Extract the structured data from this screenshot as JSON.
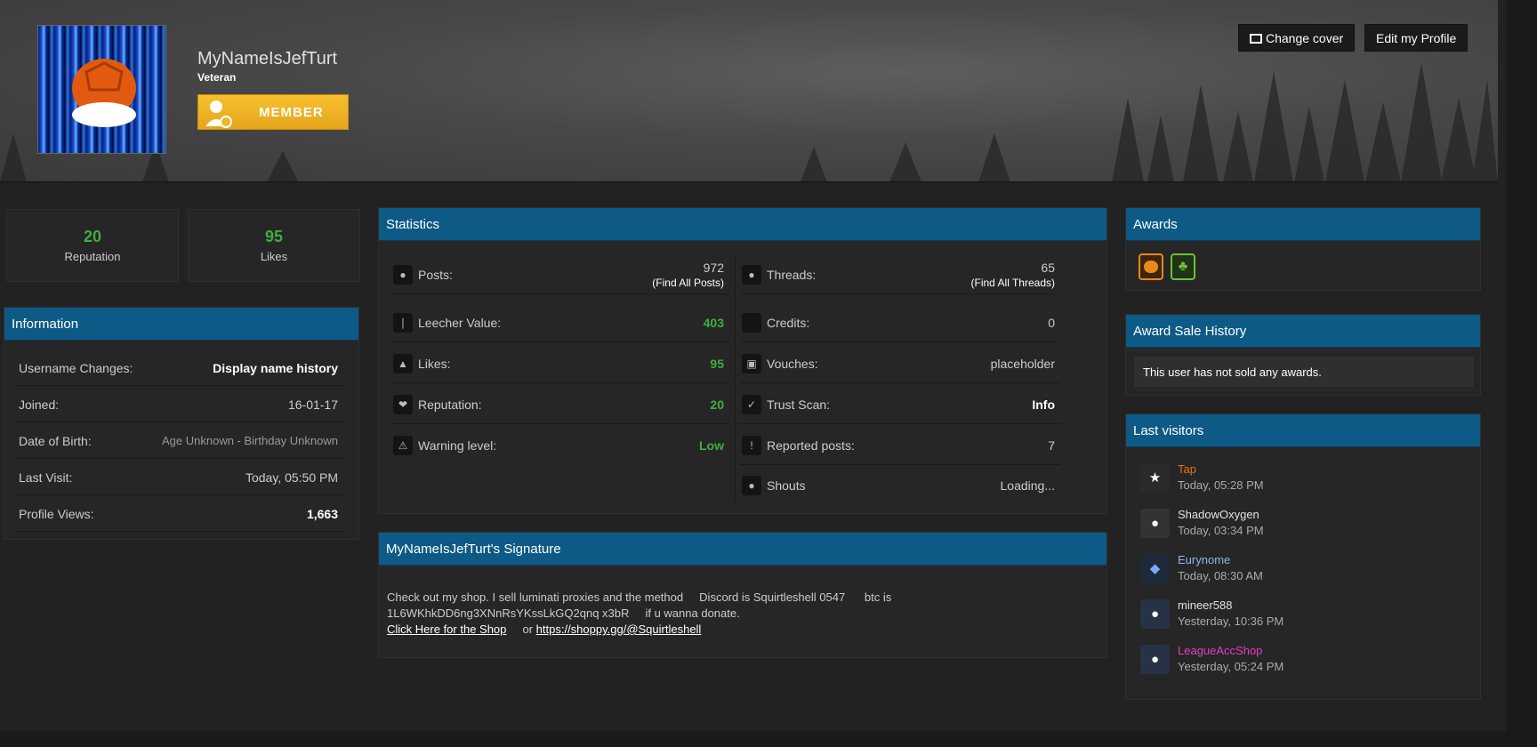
{
  "cover": {
    "username": "MyNameIsJefTurt",
    "rank": "Veteran",
    "badge": "MEMBER",
    "change_cover": "Change cover",
    "edit_profile": "Edit my Profile"
  },
  "stats_boxes": [
    {
      "value": "20",
      "label": "Reputation"
    },
    {
      "value": "95",
      "label": "Likes"
    }
  ],
  "information": {
    "title": "Information",
    "rows": [
      {
        "label": "Username Changes:",
        "value": "Display name history"
      },
      {
        "label": "Joined:",
        "value": "16-01-17"
      },
      {
        "label": "Date of Birth:",
        "value": "Age Unknown - Birthday Unknown"
      },
      {
        "label": "Last Visit:",
        "value": "Today, 05:50 PM"
      },
      {
        "label": "Profile Views:",
        "value": "1,663"
      }
    ]
  },
  "statistics": {
    "title": "Statistics",
    "left": [
      {
        "label": "Posts:",
        "value": "972",
        "sub": "(Find All Posts)",
        "icon": "comment-icon"
      },
      {
        "label": "Leecher Value:",
        "value": "403",
        "icon": "thermometer-icon"
      },
      {
        "label": "Likes:",
        "value": "95",
        "icon": "thumbs-up-icon"
      },
      {
        "label": "Reputation:",
        "value": "20",
        "icon": "ribbon-icon"
      },
      {
        "label": "Warning level:",
        "value": "Low",
        "icon": "warning-icon"
      }
    ],
    "right": [
      {
        "label": "Threads:",
        "value": "65",
        "sub": "(Find All Threads)",
        "icon": "comments-icon"
      },
      {
        "label": "Credits:",
        "value": "0",
        "icon": "credits-icon"
      },
      {
        "label": "Vouches:",
        "value": "placeholder",
        "icon": "cart-icon"
      },
      {
        "label": "Trust Scan:",
        "value": "Info",
        "icon": "checkbox-icon"
      },
      {
        "label": "Reported posts:",
        "value": "7",
        "icon": "info-icon"
      },
      {
        "label": "Shouts",
        "value": "Loading...",
        "icon": "comments-icon"
      }
    ]
  },
  "signature": {
    "title": "MyNameIsJefTurt's Signature",
    "line1": "Check out my shop. I sell luminati proxies and the method     Discord is Squirtleshell 0547      btc is 1L6WKhkDD6ng3XNnRsYKssLkGQ2qnq x3bR     if u wanna donate.",
    "link1": "Click Here for the Shop",
    "or": "or",
    "link2": "https://shoppy.gg/@Squirtleshell"
  },
  "awards": {
    "title": "Awards",
    "items": [
      {
        "icon": "pumpkin-icon",
        "color": "#e8891a"
      },
      {
        "icon": "clover-icon",
        "color": "#6fbf3a"
      }
    ]
  },
  "award_sale": {
    "title": "Award Sale History",
    "text": "This user has not sold any awards."
  },
  "last_visitors": {
    "title": "Last visitors",
    "items": [
      {
        "name": "Tap",
        "time": "Today, 05:28 PM",
        "color": "#e8701a"
      },
      {
        "name": "ShadowOxygen",
        "time": "Today, 03:34 PM",
        "color": "#e0e0e0"
      },
      {
        "name": "Eurynome",
        "time": "Today, 08:30 AM",
        "color": "#8fb5e8"
      },
      {
        "name": "mineer588",
        "time": "Yesterday, 10:36 PM",
        "color": "#e0e0e0"
      },
      {
        "name": "LeagueAccShop",
        "time": "Yesterday, 05:24 PM",
        "color": "#e040c0"
      }
    ]
  }
}
